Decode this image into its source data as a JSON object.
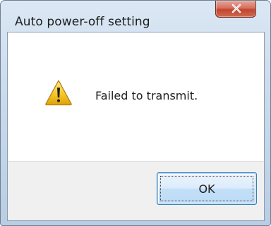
{
  "window": {
    "title": "Auto power-off setting",
    "close_icon": "close-icon"
  },
  "message": {
    "icon": "warning-icon",
    "text": "Failed to transmit."
  },
  "buttons": {
    "ok_label": "OK"
  },
  "colors": {
    "close_button": "#c8503a",
    "warning_yellow": "#f6cc2e",
    "ok_border": "#3c7fb1"
  }
}
